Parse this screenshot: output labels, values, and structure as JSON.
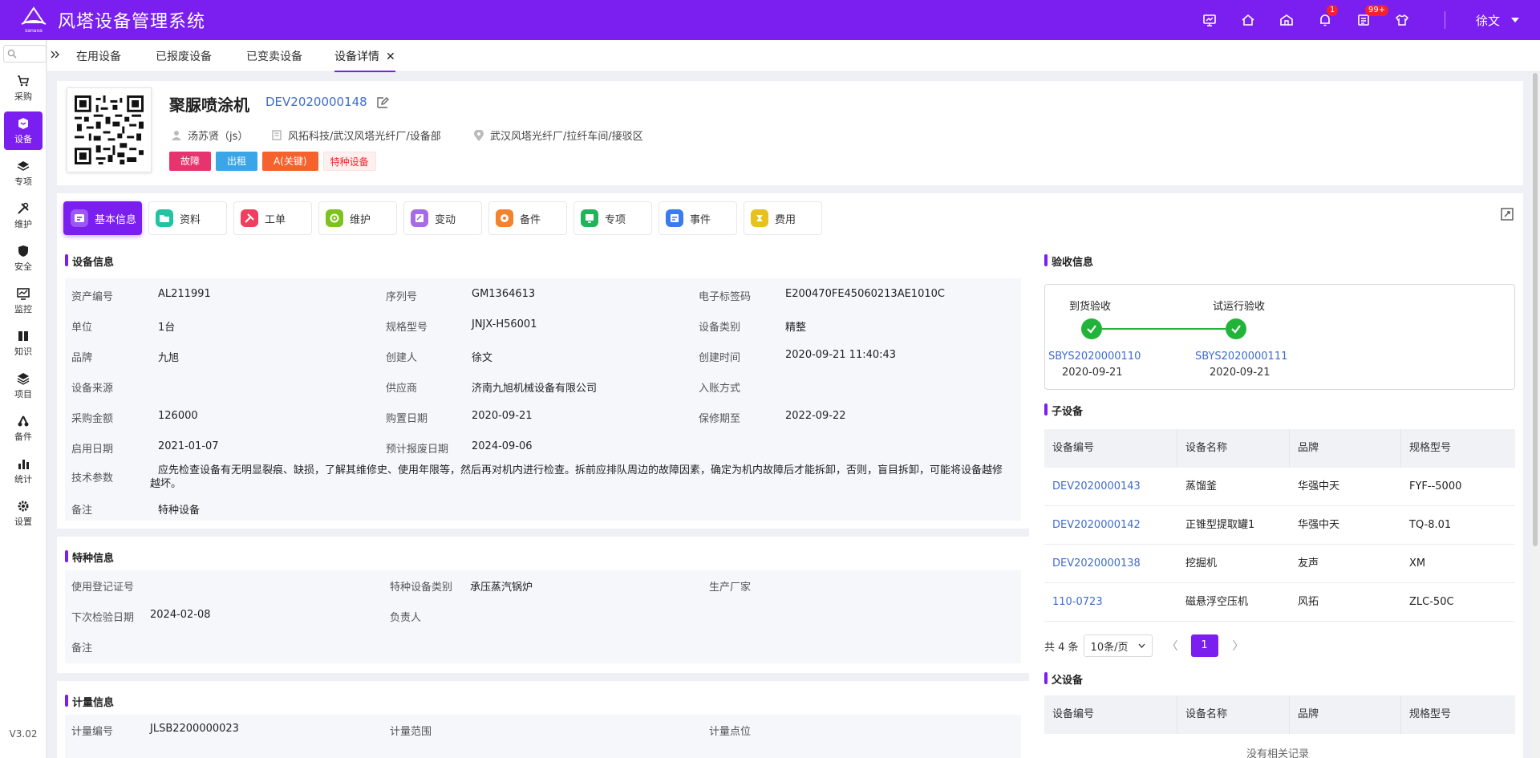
{
  "app": {
    "title": "风塔设备管理系统",
    "logo_text": "sanaoa",
    "user_name": "徐文",
    "version": "V3.02",
    "badges": {
      "notifications": "1",
      "messages": "99+"
    },
    "accent_color": "#7b1ff0"
  },
  "sidebar": {
    "items": [
      {
        "label": "采购",
        "icon": "cart-icon"
      },
      {
        "label": "设备",
        "icon": "device-icon",
        "active": true
      },
      {
        "label": "专项",
        "icon": "layers-icon"
      },
      {
        "label": "维护",
        "icon": "tools-icon"
      },
      {
        "label": "安全",
        "icon": "shield-icon"
      },
      {
        "label": "监控",
        "icon": "monitor-icon"
      },
      {
        "label": "知识",
        "icon": "book-icon"
      },
      {
        "label": "项目",
        "icon": "stack-icon"
      },
      {
        "label": "备件",
        "icon": "parts-icon"
      },
      {
        "label": "统计",
        "icon": "bar-chart-icon"
      },
      {
        "label": "设置",
        "icon": "gear-icon"
      }
    ]
  },
  "tabs": [
    {
      "label": "在用设备"
    },
    {
      "label": "已报废设备"
    },
    {
      "label": "已变卖设备"
    },
    {
      "label": "设备详情",
      "active": true,
      "closable": true
    }
  ],
  "device": {
    "name": "聚脲喷涂机",
    "code": "DEV2020000148",
    "owner": "汤苏贤（js）",
    "department": "风拓科技/武汉风塔光纤厂/设备部",
    "location": "武汉风塔光纤厂/拉纤车间/接驳区",
    "tags": [
      "故障",
      "出租",
      "A(关键)",
      "特种设备"
    ]
  },
  "module_tabs": [
    "基本信息",
    "资料",
    "工单",
    "维护",
    "变动",
    "备件",
    "专项",
    "事件",
    "费用"
  ],
  "device_info": {
    "title": "设备信息",
    "rows": [
      [
        [
          "资产编号",
          "AL211991"
        ],
        [
          "序列号",
          "GM1364613"
        ],
        [
          "电子标签码",
          "E200470FE45060213AE1010C"
        ]
      ],
      [
        [
          "单位",
          "1台"
        ],
        [
          "规格型号",
          "JNJX-H56001"
        ],
        [
          "设备类别",
          "精整"
        ]
      ],
      [
        [
          "品牌",
          "九旭"
        ],
        [
          "创建人",
          "徐文"
        ],
        [
          "创建时间",
          "2020-09-21 11:40:43"
        ]
      ],
      [
        [
          "设备来源",
          ""
        ],
        [
          "供应商",
          "济南九旭机械设备有限公司"
        ],
        [
          "入账方式",
          ""
        ]
      ],
      [
        [
          "采购金额",
          "126000"
        ],
        [
          "购置日期",
          "2020-09-21"
        ],
        [
          "保修期至",
          "2022-09-22"
        ]
      ],
      [
        [
          "启用日期",
          "2021-01-07"
        ],
        [
          "预计报废日期",
          "2024-09-06"
        ],
        [
          "",
          ""
        ]
      ]
    ],
    "tech_label": "技术参数",
    "tech_value": "应先检查设备有无明显裂痕、缺损，了解其维修史、使用年限等，然后再对机内进行检查。拆前应排队周边的故障因素，确定为机内故障后才能拆卸，否则，盲目拆卸，可能将设备越修越坏。",
    "remark_label": "备注",
    "remark_value": "特种设备"
  },
  "special_info": {
    "title": "特种信息",
    "rows": [
      [
        [
          "使用登记证号",
          ""
        ],
        [
          "特种设备类别",
          "承压蒸汽锅炉"
        ],
        [
          "生产厂家",
          ""
        ]
      ],
      [
        [
          "下次检验日期",
          "2024-02-08"
        ],
        [
          "负责人",
          ""
        ],
        [
          "",
          ""
        ]
      ],
      [
        [
          "备注",
          ""
        ],
        [
          "",
          ""
        ],
        [
          "",
          ""
        ]
      ]
    ]
  },
  "metering_info": {
    "title": "计量信息",
    "rows": [
      [
        [
          "计量编号",
          "JLSB2200000023"
        ],
        [
          "计量范围",
          ""
        ],
        [
          "计量点位",
          ""
        ]
      ]
    ]
  },
  "acceptance": {
    "title": "验收信息",
    "steps": [
      {
        "title": "到货验收",
        "code": "SBYS2020000110",
        "date": "2020-09-21"
      },
      {
        "title": "试运行验收",
        "code": "SBYS2020000111",
        "date": "2020-09-21"
      }
    ]
  },
  "sub_devices": {
    "title": "子设备",
    "columns": [
      "设备编号",
      "设备名称",
      "品牌",
      "规格型号"
    ],
    "rows": [
      [
        "DEV2020000143",
        "蒸馏釜",
        "华强中天",
        "FYF--5000"
      ],
      [
        "DEV2020000142",
        "正锥型提取罐1",
        "华强中天",
        "TQ-8.01"
      ],
      [
        "DEV2020000138",
        "挖掘机",
        "友声",
        "XM"
      ],
      [
        "110-0723",
        "磁悬浮空压机",
        "风拓",
        "ZLC-50C"
      ]
    ],
    "total": "共 4 条",
    "page_size": "10条/页",
    "page": "1"
  },
  "parent_devices": {
    "title": "父设备",
    "columns": [
      "设备编号",
      "设备名称",
      "品牌",
      "规格型号"
    ],
    "empty": "没有相关记录"
  }
}
